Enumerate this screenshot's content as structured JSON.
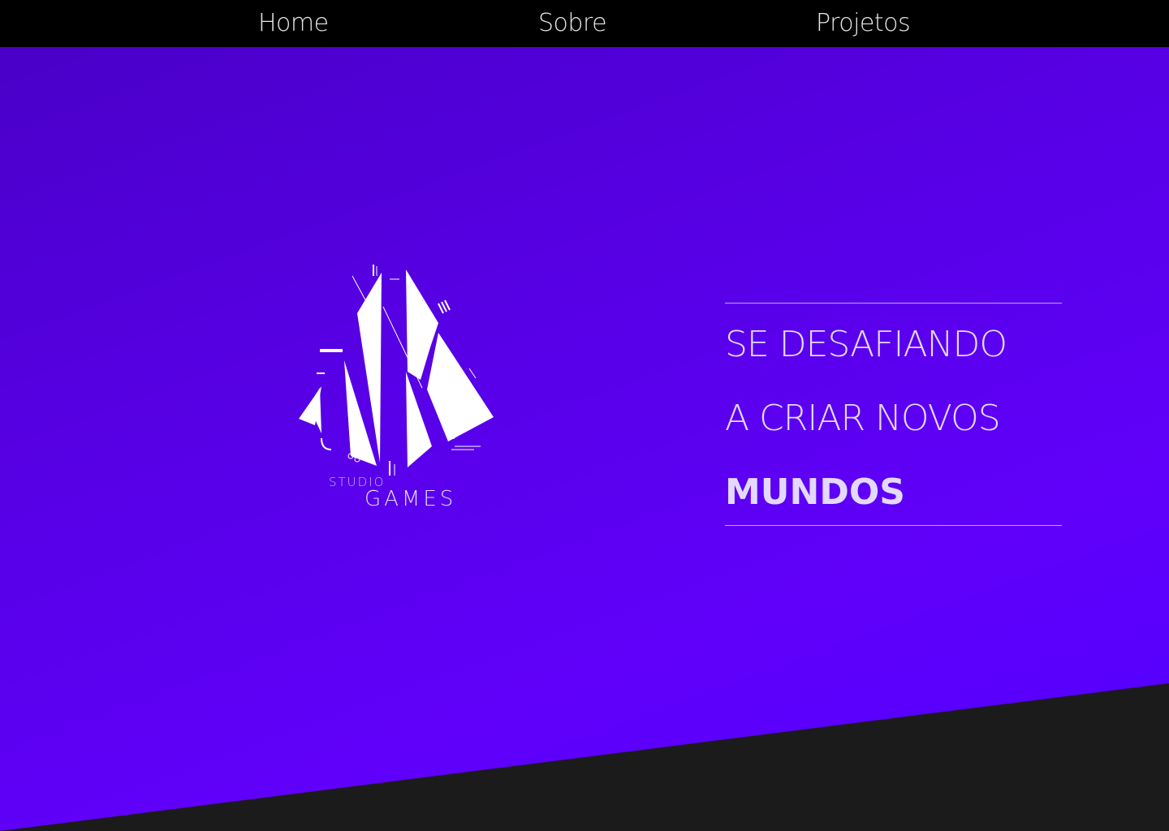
{
  "nav": {
    "items": [
      {
        "label": "Home"
      },
      {
        "label": "Sobre"
      },
      {
        "label": "Projetos"
      }
    ]
  },
  "logo": {
    "studio": "STUDIO",
    "games": "GAMES"
  },
  "hero": {
    "line1": "SE DESAFIANDO",
    "line2": "A CRIAR NOVOS",
    "line3": "MUNDOS"
  },
  "colors": {
    "nav_background": "#000000",
    "hero_gradient_start": "#4a00c8",
    "hero_gradient_end": "#6000fa",
    "floor": "#1b1b1b",
    "text": "#e3d9ff"
  }
}
